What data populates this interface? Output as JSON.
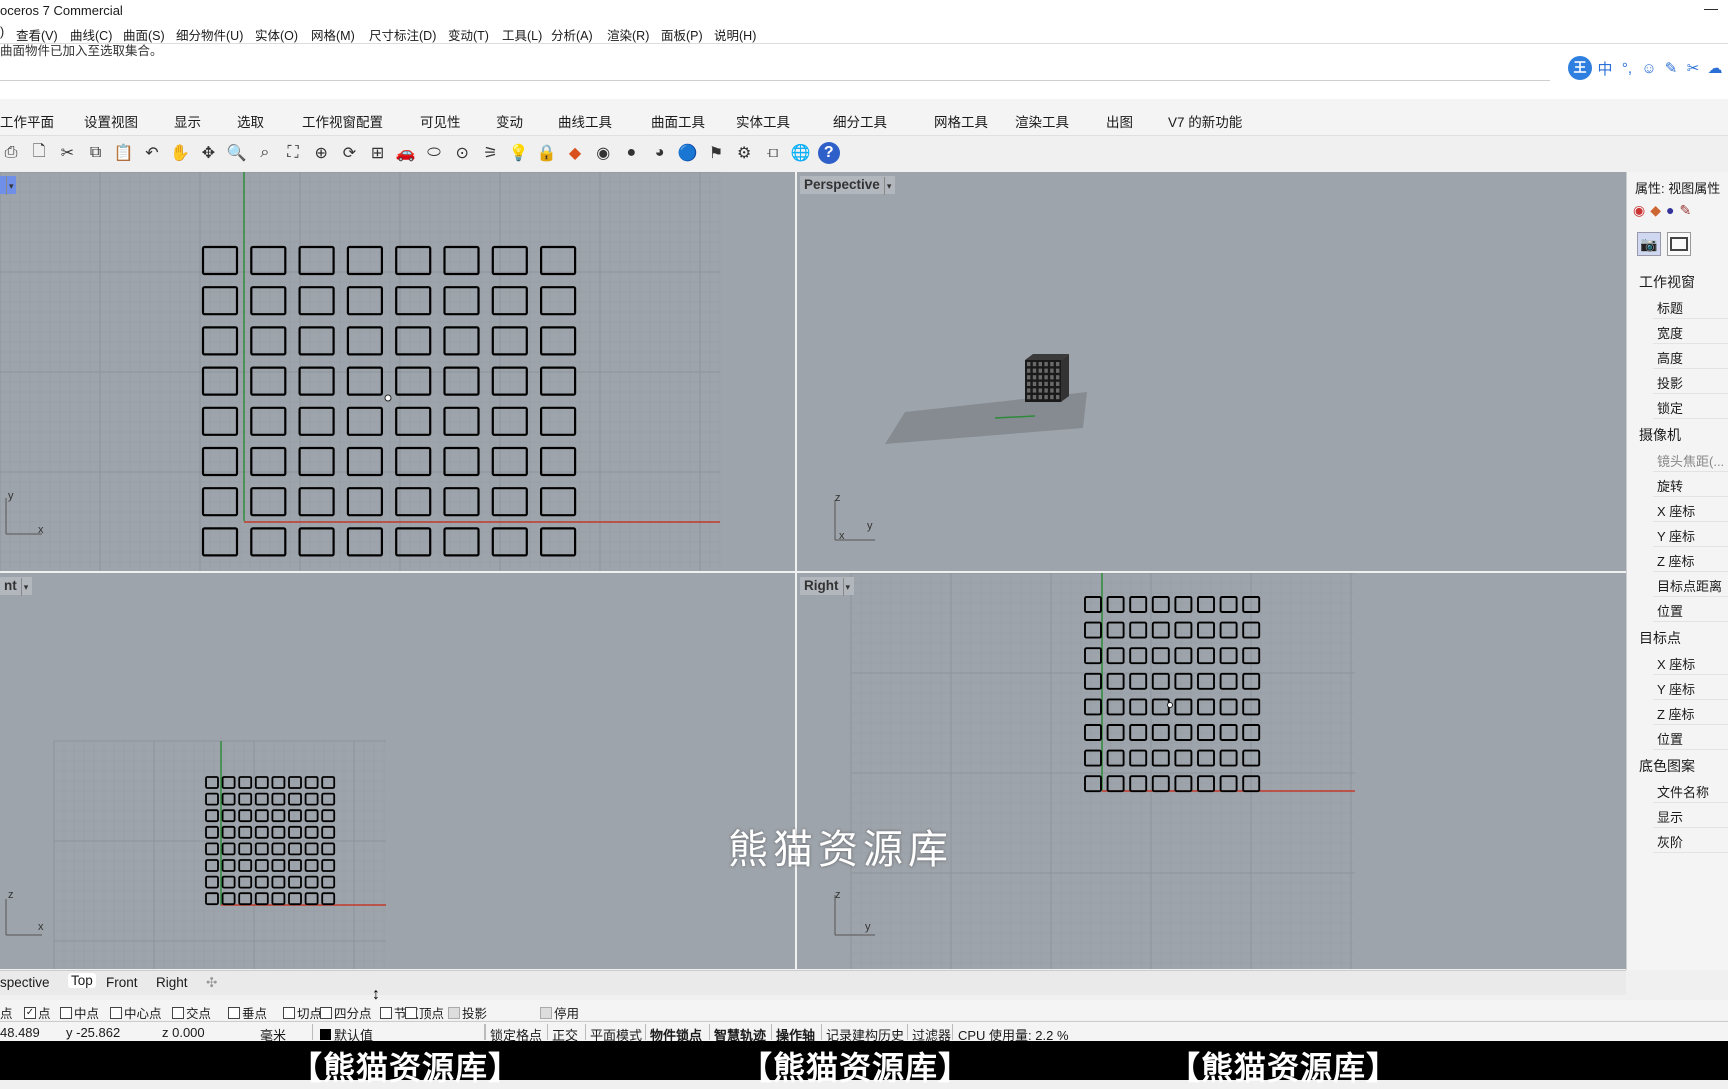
{
  "app": {
    "title": "oceros 7 Commercial"
  },
  "menu": [
    "查看(V)",
    "曲线(C)",
    "曲面(S)",
    "细分物件(U)",
    "实体(O)",
    "网格(M)",
    "尺寸标注(D)",
    "变动(T)",
    "工具(L)",
    "分析(A)",
    "渲染(R)",
    "面板(P)",
    "说明(H)"
  ],
  "command": {
    "history": "曲面物件已加入至选取集合。"
  },
  "ime": {
    "brand": "王",
    "mode": "中"
  },
  "tabs": [
    "工作平面",
    "设置视图",
    "显示",
    "选取",
    "工作视窗配置",
    "可见性",
    "变动",
    "曲线工具",
    "曲面工具",
    "实体工具",
    "细分工具",
    "网格工具",
    "渲染工具",
    "出图",
    "V7 的新功能"
  ],
  "toolbar_icons": [
    "print-icon",
    "new-icon",
    "cut-icon",
    "copy-icon",
    "paste-icon",
    "undo-icon",
    "pan-hand-icon",
    "rotate-view-icon",
    "zoom-icon",
    "zoom-window-icon",
    "zoom-extents-icon",
    "zoom-selected-icon",
    "rotate-icon",
    "four-viewports-icon",
    "car-icon",
    "cplane-icon",
    "named-view-icon",
    "snapshot-icon",
    "light-icon",
    "lock-icon",
    "layer-icon",
    "color-wheel-icon",
    "material-sphere-icon",
    "render-sphere-icon",
    "blue-sphere-icon",
    "flag-icon",
    "gear-icon",
    "arrange-icon",
    "globe-icon",
    "help-icon"
  ],
  "viewports": {
    "top": {
      "label": "",
      "axes": [
        "y",
        "x"
      ],
      "grid": {
        "rows": 8,
        "cols": 8
      }
    },
    "perspective": {
      "label": "Perspective",
      "axes": [
        "z",
        "y",
        "x"
      ]
    },
    "front": {
      "label": "nt",
      "axes": [
        "z",
        "x"
      ],
      "grid": {
        "rows": 8,
        "cols": 8
      }
    },
    "right": {
      "label": "Right",
      "axes": [
        "z",
        "y"
      ],
      "grid": {
        "rows": 8,
        "cols": 8
      }
    }
  },
  "panel": {
    "title": "属性: 视图属性",
    "sections": [
      {
        "name": "工作视窗",
        "items": [
          "标题",
          "宽度",
          "高度",
          "投影",
          "锁定"
        ]
      },
      {
        "name": "摄像机",
        "items": [
          "镜头焦距(...",
          "旋转",
          "X 座标",
          "Y 座标",
          "Z 座标",
          "目标点距离",
          "位置"
        ]
      },
      {
        "name": "目标点",
        "items": [
          "X 座标",
          "Y 座标",
          "Z 座标",
          "位置"
        ]
      },
      {
        "name": "底色图案",
        "items": [
          "文件名称",
          "显示",
          "灰阶"
        ]
      }
    ]
  },
  "viewport_tabs": [
    "spective",
    "Top",
    "Front",
    "Right"
  ],
  "osnaps": [
    {
      "label": "端点",
      "checked": false,
      "prefix": "点"
    },
    {
      "label": "点",
      "checked": true
    },
    {
      "label": "中点",
      "checked": false
    },
    {
      "label": "中心点",
      "checked": false
    },
    {
      "label": "交点",
      "checked": false
    },
    {
      "label": "垂点",
      "checked": false
    },
    {
      "label": "切点",
      "checked": false
    },
    {
      "label": "四分点",
      "checked": false
    },
    {
      "label": "节点",
      "checked": false
    },
    {
      "label": "顶点",
      "checked": false
    },
    {
      "label": "投影",
      "checked": false
    },
    {
      "label": "停用",
      "checked": false
    }
  ],
  "status": {
    "x": "48.489",
    "y": "y -25.862",
    "z": "z 0.000",
    "units": "毫米",
    "layer": "默认值",
    "toggles": [
      "锁定格点",
      "正交",
      "平面模式",
      "物件锁点",
      "智慧轨迹",
      "操作轴",
      "记录建构历史",
      "过滤器"
    ],
    "cpu": "CPU 使用量: 2.2 %"
  },
  "watermarks": {
    "band": [
      "【熊猫资源库】",
      "【熊猫资源库】",
      "【熊猫资源库】"
    ],
    "center": "熊猫资源库"
  },
  "colors": {
    "viewport_bg": "#9ea4ab",
    "x_axis": "#c0392b",
    "y_axis": "#2e8b3a",
    "active_label": "#6f8fe8"
  }
}
